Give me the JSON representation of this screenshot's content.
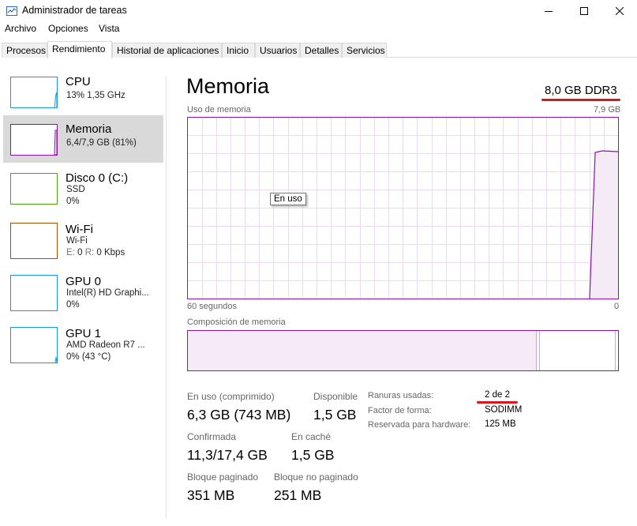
{
  "window": {
    "title": "Administrador de tareas",
    "icon": "task-manager-icon"
  },
  "menu": [
    "Archivo",
    "Opciones",
    "Vista"
  ],
  "tabs": [
    {
      "label": "Procesos",
      "active": false
    },
    {
      "label": "Rendimiento",
      "active": true
    },
    {
      "label": "Historial de aplicaciones",
      "active": false
    },
    {
      "label": "Inicio",
      "active": false
    },
    {
      "label": "Usuarios",
      "active": false
    },
    {
      "label": "Detalles",
      "active": false
    },
    {
      "label": "Servicios",
      "active": false
    }
  ],
  "sidebar": [
    {
      "title": "CPU",
      "line1": "13% 1,35 GHz",
      "line2": "",
      "color": "#1a9ad7",
      "active": false
    },
    {
      "title": "Memoria",
      "line1": "6,4/7,9 GB (81%)",
      "line2": "",
      "color": "#8b12ae",
      "active": true
    },
    {
      "title": "Disco 0 (C:)",
      "line1": "SSD",
      "line2": "0%",
      "color": "#4da60c",
      "active": false
    },
    {
      "title": "Wi-Fi",
      "line1": "Wi-Fi",
      "line2_parts": {
        "e_label": "E:",
        "e_value": "0",
        "r_label": "R:",
        "r_value": "0 Kbps"
      },
      "color": "#a74f01",
      "active": false
    },
    {
      "title": "GPU 0",
      "line1": "Intel(R) HD Graphi...",
      "line2": "0%",
      "color": "#1a9ad7",
      "active": false
    },
    {
      "title": "GPU 1",
      "line1": "AMD Radeon R7 ...",
      "line2": "0% (43 °C)",
      "color": "#1a9ad7",
      "active": false
    }
  ],
  "main": {
    "title": "Memoria",
    "memory_type": "8,0 GB DDR3",
    "graph_label": "Uso de memoria",
    "graph_max": "7,9 GB",
    "graph_time": "60 segundos",
    "graph_min": "0",
    "tooltip": "En uso",
    "composition_label": "Composición de memoria",
    "accent": "#8b12ae",
    "stats": {
      "in_use_label": "En uso (comprimido)",
      "in_use_value": "6,3 GB (743 MB)",
      "available_label": "Disponible",
      "available_value": "1,5 GB",
      "committed_label": "Confirmada",
      "committed_value": "11,3/17,4 GB",
      "cached_label": "En caché",
      "cached_value": "1,5 GB",
      "paged_label": "Bloque paginado",
      "paged_value": "351 MB",
      "nonpaged_label": "Bloque no paginado",
      "nonpaged_value": "251 MB"
    },
    "info": {
      "slots_label": "Ranuras usadas:",
      "slots_value": "2 de 2",
      "form_label": "Factor de forma:",
      "form_value": "SODIMM",
      "reserved_label": "Reservada para hardware:",
      "reserved_value": "125 MB"
    }
  }
}
